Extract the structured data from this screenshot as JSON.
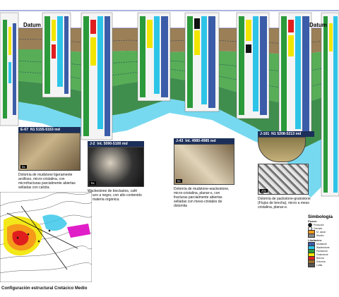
{
  "datum_label": "Datum",
  "wells": [
    {
      "name": "E-67",
      "interval": "N1 5155-5163 md",
      "description": "Dolomía de mudstone ligeramente arcilloso, micro-cristalina, con microfracturas parcialmente abiertas selladas con calcita.",
      "magnification": "5x"
    },
    {
      "name": "J-2",
      "interval": "Int. 5090-5100 md",
      "description": "Wackestone de bioclastos, café oscuro a negro, con alto contenido de materia orgánica.",
      "magnification": "5x"
    },
    {
      "name": "J-43",
      "interval": "Int. 4980-4985 md",
      "description": "Dolomía de mudstone-wackestone, micro-cristalina, planar-s, con fracturas parcialmente abiertas selladas con meso-cristales de dolomita",
      "magnification": "5x"
    },
    {
      "name": "J-101",
      "interval": "N1 5208-5213 md",
      "description": "Dolomía de packstone-grainstone (Flujos de brecha), micro a meso cristalina, planar-e.",
      "magnification": "20x"
    }
  ],
  "map": {
    "title": "Configuración estructural Cretácico Medio"
  },
  "legend": {
    "title": "Simbología",
    "sections": [
      {
        "label": "Pozos:",
        "items": [
          "Productor",
          "Cerrado",
          "M. canal",
          "Núcleo"
        ]
      },
      {
        "label": "Litofacies:",
        "items": [
          "Mudstone",
          "Wackestone",
          "Packstone",
          "Grainstone",
          "Brecha",
          "Dolomía",
          "Lutita"
        ]
      }
    ]
  },
  "colors": {
    "green": "#3aa03a",
    "cyan": "#2ec4e8",
    "yellow": "#f2e600",
    "brown": "#9a6b2f",
    "navy": "#1c2f5a",
    "orange": "#f59a1a",
    "magenta": "#e01ec8"
  }
}
